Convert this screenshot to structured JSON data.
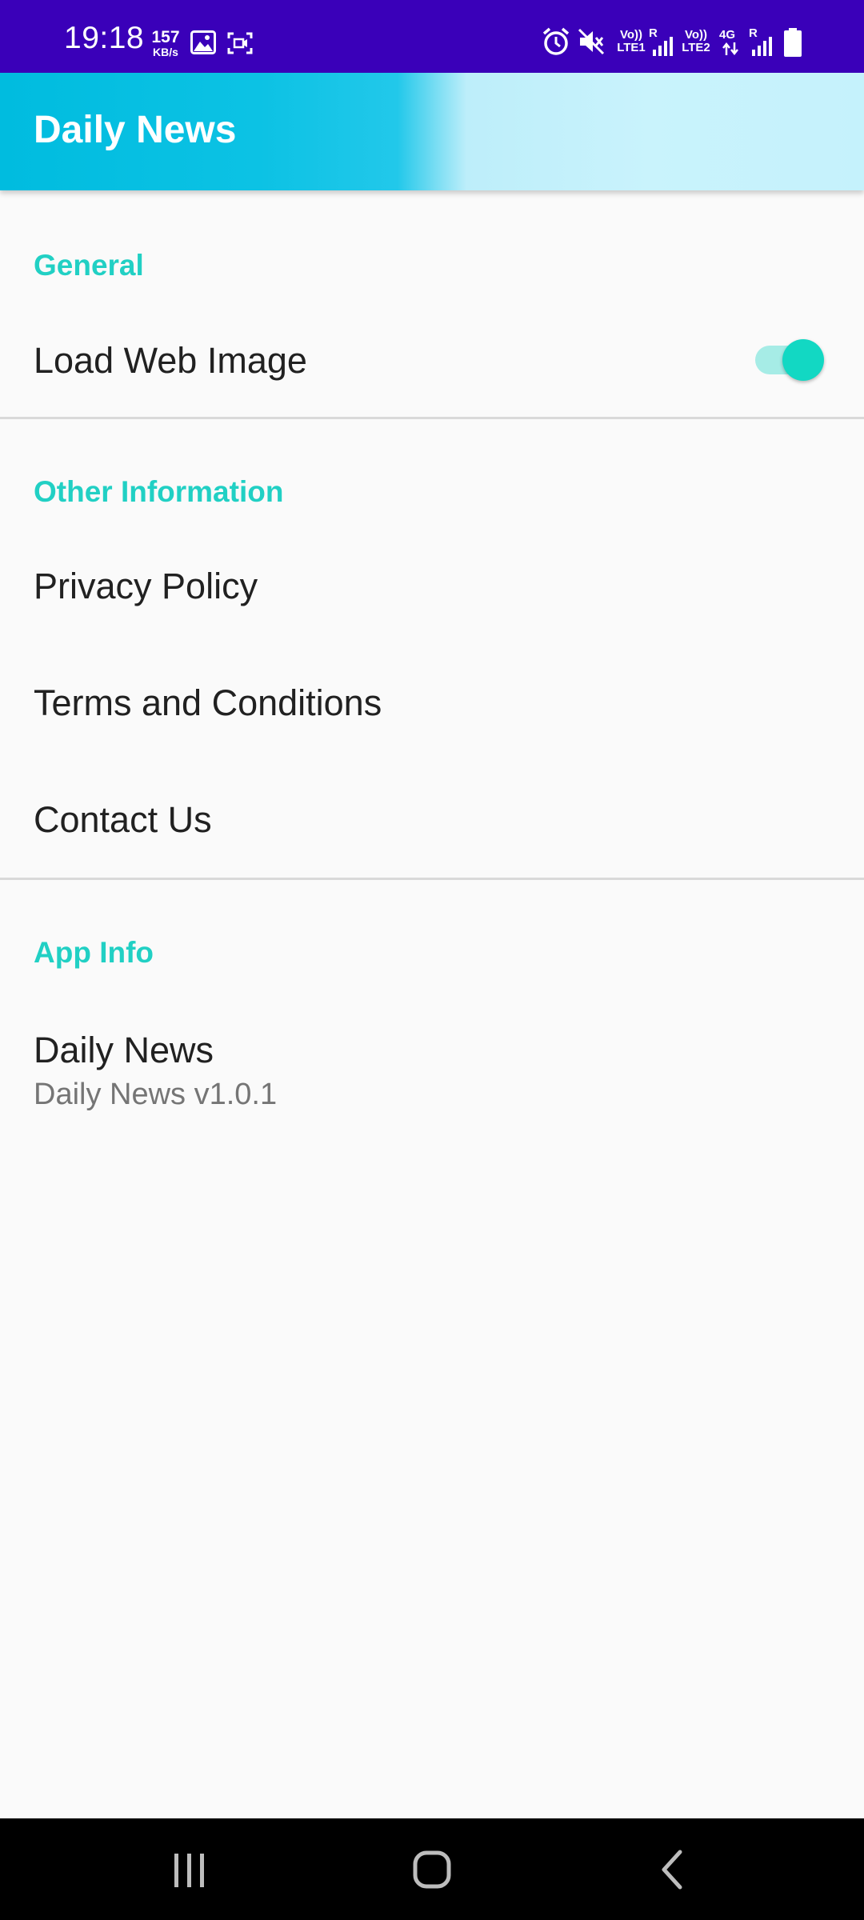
{
  "status_bar": {
    "time": "19:18",
    "net_speed_value": "157",
    "net_speed_unit": "KB/s",
    "sim1_label": "Vo)) LTE1",
    "sim1_roaming": "R",
    "sim2_label": "Vo)) LTE2",
    "sim2_network": "4G",
    "sim2_roaming": "R",
    "icons": [
      "gallery-icon",
      "screen-record-icon",
      "alarm-icon",
      "mute-icon",
      "signal-icon",
      "battery-icon"
    ]
  },
  "app_bar": {
    "title": "Daily News"
  },
  "settings": {
    "general": {
      "header": "General",
      "load_web_image": {
        "title": "Load Web Image",
        "enabled": true
      }
    },
    "other_information": {
      "header": "Other Information",
      "items": [
        "Privacy Policy",
        "Terms and Conditions",
        "Contact Us"
      ]
    },
    "app_info": {
      "header": "App Info",
      "title": "Daily News",
      "summary": "Daily News v1.0.1"
    }
  },
  "nav_bar": {
    "buttons": [
      "recent-apps-icon",
      "home-icon",
      "back-icon"
    ]
  },
  "colors": {
    "status_bar": "#3a00b9",
    "accent": "#21d0c4",
    "switch_thumb": "#12d8c3",
    "switch_track": "#a6ece6",
    "app_bar_start": "#00bcdf",
    "app_bar_end": "#c5f2fc"
  }
}
